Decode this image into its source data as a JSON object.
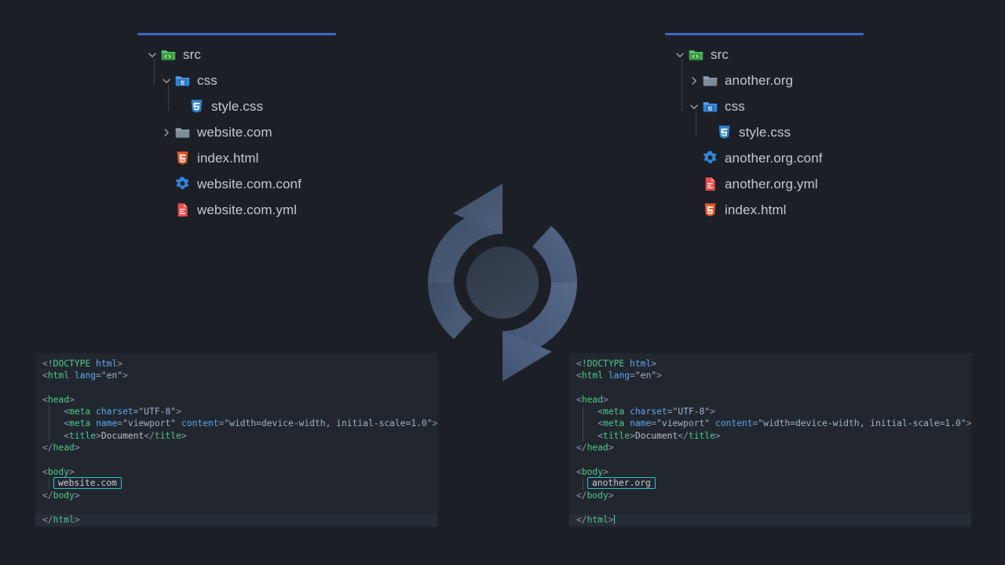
{
  "background_color": "#1c2026",
  "accent_rule_color": "#3d68c4",
  "highlight_box_color": "#2ec4c4",
  "center_icon": {
    "name": "sync-refresh-icon",
    "label": "sync"
  },
  "trees": {
    "left": {
      "name": "left-file-tree",
      "items": [
        {
          "label": "src",
          "icon": "folder-src-code-icon",
          "depth": 0,
          "twisty": "expanded",
          "kind": "folder"
        },
        {
          "label": "css",
          "icon": "folder-css-icon",
          "depth": 1,
          "twisty": "expanded",
          "kind": "folder"
        },
        {
          "label": "style.css",
          "icon": "css3-file-icon",
          "depth": 2,
          "twisty": "none",
          "kind": "file"
        },
        {
          "label": "website.com",
          "icon": "folder-plain-icon",
          "depth": 1,
          "twisty": "collapsed",
          "kind": "folder"
        },
        {
          "label": "index.html",
          "icon": "html5-file-icon",
          "depth": 1,
          "twisty": "none",
          "kind": "file"
        },
        {
          "label": "website.com.conf",
          "icon": "gear-config-file-icon",
          "depth": 1,
          "twisty": "none",
          "kind": "file"
        },
        {
          "label": "website.com.yml",
          "icon": "yaml-file-icon",
          "depth": 1,
          "twisty": "none",
          "kind": "file"
        }
      ]
    },
    "right": {
      "name": "right-file-tree",
      "items": [
        {
          "label": "src",
          "icon": "folder-src-code-icon",
          "depth": 0,
          "twisty": "expanded",
          "kind": "folder"
        },
        {
          "label": "another.org",
          "icon": "folder-plain-icon",
          "depth": 1,
          "twisty": "collapsed",
          "kind": "folder"
        },
        {
          "label": "css",
          "icon": "folder-css-icon",
          "depth": 1,
          "twisty": "expanded",
          "kind": "folder"
        },
        {
          "label": "style.css",
          "icon": "css3-file-icon",
          "depth": 2,
          "twisty": "none",
          "kind": "file"
        },
        {
          "label": "another.org.conf",
          "icon": "gear-config-file-icon",
          "depth": 1,
          "twisty": "none",
          "kind": "file"
        },
        {
          "label": "another.org.yml",
          "icon": "yaml-file-icon",
          "depth": 1,
          "twisty": "none",
          "kind": "file"
        },
        {
          "label": "index.html",
          "icon": "html5-file-icon",
          "depth": 1,
          "twisty": "none",
          "kind": "file"
        }
      ]
    }
  },
  "code": {
    "left": {
      "name": "left-code-editor",
      "highlighted_value": "website.com",
      "has_caret": false,
      "lines": [
        "<!DOCTYPE html>",
        "<html lang=\"en\">",
        "",
        "<head>",
        "    <meta charset=\"UTF-8\">",
        "    <meta name=\"viewport\" content=\"width=device-width, initial-scale=1.0\">",
        "    <title>Document</title>",
        "</head>",
        "",
        "<body>",
        "    website.com",
        "</body>",
        "",
        "</html>"
      ]
    },
    "right": {
      "name": "right-code-editor",
      "highlighted_value": "another.org",
      "has_caret": true,
      "lines": [
        "<!DOCTYPE html>",
        "<html lang=\"en\">",
        "",
        "<head>",
        "    <meta charset=\"UTF-8\">",
        "    <meta name=\"viewport\" content=\"width=device-width, initial-scale=1.0\">",
        "    <title>Document</title>",
        "</head>",
        "",
        "<body>",
        "    another.org",
        "</body>",
        "",
        "</html>"
      ]
    }
  }
}
